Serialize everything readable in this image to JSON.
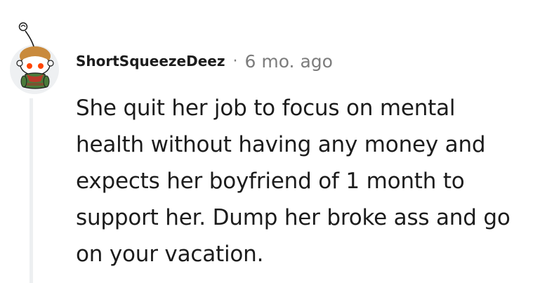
{
  "comment": {
    "author": "ShortSqueezeDeez",
    "separator": "·",
    "timestamp": "6 mo. ago",
    "body": "She quit her job to focus on mental health without having any money and expects her boyfriend of 1 month to support her. Dump her broke ass and go on your vacation.",
    "avatar_icon": "reddit-snoo-avatar-icon"
  },
  "colors": {
    "text": "#1c1c1c",
    "meta": "#7c7c7c",
    "thread_line": "#edeff1",
    "avatar_bg": "#eef0f2"
  }
}
